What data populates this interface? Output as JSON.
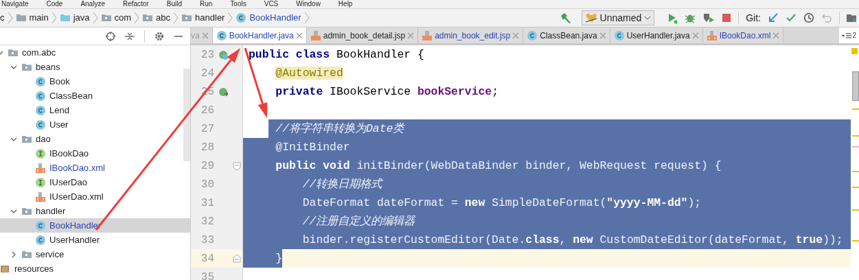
{
  "menu_bar": [
    "Navigate",
    "Code",
    "Analyze",
    "Refactor",
    "Build",
    "Run",
    "Tools",
    "VCS",
    "Window",
    "Help"
  ],
  "breadcrumbs": [
    {
      "label": "c",
      "kind": "cut"
    },
    {
      "label": "main",
      "kind": "folder"
    },
    {
      "label": "java",
      "kind": "source"
    },
    {
      "label": "com",
      "kind": "package"
    },
    {
      "label": "abc",
      "kind": "package"
    },
    {
      "label": "handler",
      "kind": "package"
    },
    {
      "label": "BookHandler",
      "kind": "class"
    }
  ],
  "toolbar": {
    "run_config": "Unnamed",
    "git_label": "Git:"
  },
  "tabs": [
    {
      "label": "va",
      "kind": "cut",
      "selected": false,
      "modified": false
    },
    {
      "label": "BookHandler.java",
      "kind": "class",
      "selected": true,
      "modified": true
    },
    {
      "label": "admin_book_detail.jsp",
      "kind": "jsp",
      "selected": false,
      "modified": false
    },
    {
      "label": "admin_book_edit.jsp",
      "kind": "jsp",
      "selected": false,
      "modified": true
    },
    {
      "label": "ClassBean.java",
      "kind": "class",
      "selected": false,
      "modified": false
    },
    {
      "label": "UserHandler.java",
      "kind": "class",
      "selected": false,
      "modified": false
    },
    {
      "label": "IBookDao.xml",
      "kind": "xml",
      "selected": false,
      "modified": true
    }
  ],
  "tab_overflow": "2",
  "project_tree": [
    {
      "label": "com.abc",
      "kind": "package",
      "expanded": true,
      "children": [
        {
          "label": "beans",
          "kind": "package",
          "expanded": true,
          "children": [
            {
              "label": "Book",
              "kind": "class",
              "selected": false,
              "modified": false
            },
            {
              "label": "ClassBean",
              "kind": "class",
              "selected": false,
              "modified": false
            },
            {
              "label": "Lend",
              "kind": "class",
              "selected": false,
              "modified": false
            },
            {
              "label": "User",
              "kind": "class",
              "selected": false,
              "modified": false
            }
          ]
        },
        {
          "label": "dao",
          "kind": "package",
          "expanded": true,
          "children": [
            {
              "label": "IBookDao",
              "kind": "interface",
              "selected": false,
              "modified": false
            },
            {
              "label": "IBookDao.xml",
              "kind": "xml",
              "selected": false,
              "modified": true
            },
            {
              "label": "IUserDao",
              "kind": "interface",
              "selected": false,
              "modified": false
            },
            {
              "label": "IUserDao.xml",
              "kind": "xml",
              "selected": false,
              "modified": false
            }
          ]
        },
        {
          "label": "handler",
          "kind": "package",
          "expanded": true,
          "children": [
            {
              "label": "BookHandler",
              "kind": "class",
              "selected": true,
              "modified": true
            },
            {
              "label": "UserHandler",
              "kind": "class",
              "selected": false,
              "modified": false
            }
          ]
        },
        {
          "label": "service",
          "kind": "package",
          "expanded": false
        }
      ]
    },
    {
      "label": "resources",
      "kind": "resources"
    }
  ],
  "code_lines": [
    {
      "number": "23",
      "marker": {
        "kind": "bean"
      },
      "selected": false,
      "current": false,
      "tokens": [
        {
          "text": "public class ",
          "kind": "keyword"
        },
        {
          "text": "BookHandler {",
          "kind": "plain"
        }
      ]
    },
    {
      "number": "24",
      "selected": false,
      "current": false,
      "tokens": [
        {
          "text": "    @Autowired",
          "kind": "annotation_hl"
        }
      ]
    },
    {
      "number": "25",
      "marker": {
        "kind": "inject"
      },
      "selected": false,
      "current": false,
      "tokens": [
        {
          "text": "    private ",
          "kind": "keyword"
        },
        {
          "text": "IBookService ",
          "kind": "plain"
        },
        {
          "text": "bookService",
          "kind": "field"
        },
        {
          "text": ";",
          "kind": "plain"
        }
      ]
    },
    {
      "number": "26",
      "selected": false,
      "current": false
    },
    {
      "number": "27",
      "selected": true,
      "current": false,
      "tokens": [
        {
          "text": "    //将字符串转换为Date类",
          "kind": "comment"
        }
      ]
    },
    {
      "number": "28",
      "selected": true,
      "current": false,
      "tokens": [
        {
          "text": "    @InitBinder",
          "kind": "annotation"
        }
      ]
    },
    {
      "number": "29",
      "marker": {
        "kind": "fold"
      },
      "selected": true,
      "current": false,
      "tokens": [
        {
          "text": "    public void ",
          "kind": "keyword"
        },
        {
          "text": "initBinder(WebDataBinder binder, WebRequest request) {",
          "kind": "plain"
        }
      ]
    },
    {
      "number": "30",
      "selected": true,
      "current": false,
      "tokens": [
        {
          "text": "        //转换日期格式",
          "kind": "comment"
        }
      ]
    },
    {
      "number": "31",
      "selected": true,
      "current": false,
      "tokens": [
        {
          "text": "        DateFormat dateFormat = ",
          "kind": "plain"
        },
        {
          "text": "new ",
          "kind": "keyword"
        },
        {
          "text": "SimpleDateFormat(",
          "kind": "plain"
        },
        {
          "text": "\"yyyy-MM-dd\"",
          "kind": "string"
        },
        {
          "text": ");",
          "kind": "plain"
        }
      ]
    },
    {
      "number": "32",
      "selected": true,
      "current": false,
      "tokens": [
        {
          "text": "        //注册自定义的编辑器",
          "kind": "comment"
        }
      ]
    },
    {
      "number": "33",
      "selected": true,
      "current": false,
      "tokens": [
        {
          "text": "        binder.registerCustomEditor(Date.",
          "kind": "plain"
        },
        {
          "text": "class",
          "kind": "keyword"
        },
        {
          "text": ", ",
          "kind": "plain"
        },
        {
          "text": "new ",
          "kind": "keyword"
        },
        {
          "text": "CustomDateEditor(dateFormat, ",
          "kind": "plain"
        },
        {
          "text": "true",
          "kind": "keyword"
        },
        {
          "text": "));",
          "kind": "plain"
        }
      ]
    },
    {
      "number": "34",
      "marker": {
        "kind": "fold_end"
      },
      "selected": true,
      "current": true,
      "tokens": [
        {
          "text": "    }",
          "kind": "plain"
        }
      ]
    },
    {
      "number": "35",
      "selected": false,
      "current": false
    }
  ],
  "annotations": [
    {
      "kind": "arrow"
    },
    {
      "kind": "arrow"
    }
  ]
}
